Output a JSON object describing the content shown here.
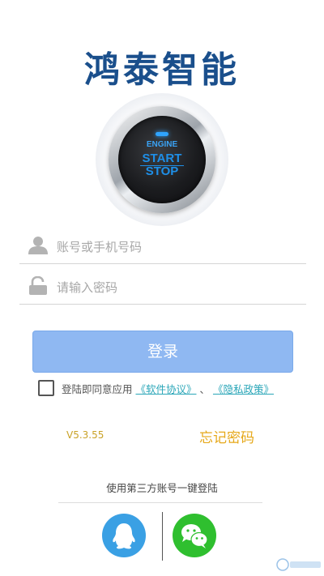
{
  "brand": {
    "title": "鸿泰智能"
  },
  "engine_button": {
    "line1": "ENGINE",
    "line2": "START",
    "line3": "STOP"
  },
  "login_form": {
    "account_placeholder": "账号或手机号码",
    "password_placeholder": "请输入密码",
    "login_label": "登录"
  },
  "agreement": {
    "prefix": "登陆即同意应用 ",
    "software_link": "《软件协议》",
    "separator": " 、 ",
    "privacy_link": "《隐私政策》",
    "checked": false
  },
  "footer_links": {
    "version": "V5.3.55",
    "forgot_password": "忘记密码"
  },
  "third_party": {
    "title": "使用第三方账号一键登陆",
    "providers": [
      {
        "icon": "qq-penguin-icon",
        "color": "#3aa0e4"
      },
      {
        "icon": "wechat-icon",
        "color": "#2fbf2f"
      }
    ]
  },
  "colors": {
    "brand": "#1a4f8c",
    "login_button": "#8fb8f2",
    "link": "#2aa6b8",
    "accent_gold": "#e6a81a"
  }
}
